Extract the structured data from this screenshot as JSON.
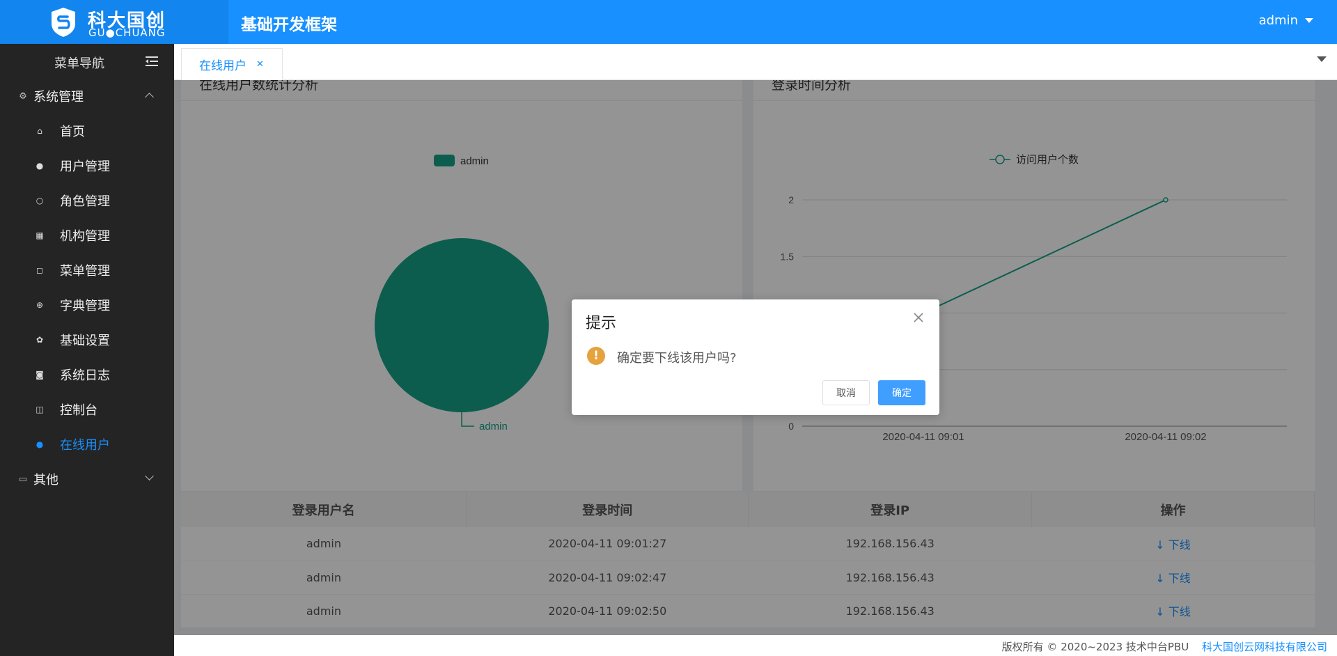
{
  "header": {
    "logo_cn": "科大国创",
    "logo_en": "GU●CHUANG",
    "app_title": "基础开发框架",
    "user": "admin"
  },
  "sidebar": {
    "title": "菜单导航",
    "groups": [
      {
        "label": "系统管理",
        "icon": "settings-gear-icon",
        "expanded": true,
        "items": [
          {
            "label": "首页",
            "icon": "home-icon"
          },
          {
            "label": "用户管理",
            "icon": "user-icon"
          },
          {
            "label": "角色管理",
            "icon": "user-outline-icon"
          },
          {
            "label": "机构管理",
            "icon": "grid-icon"
          },
          {
            "label": "菜单管理",
            "icon": "bag-icon"
          },
          {
            "label": "字典管理",
            "icon": "plus-circle-icon"
          },
          {
            "label": "基础设置",
            "icon": "cog-icon"
          },
          {
            "label": "系统日志",
            "icon": "camera-icon"
          },
          {
            "label": "控制台",
            "icon": "book-icon"
          },
          {
            "label": "在线用户",
            "icon": "user-icon",
            "active": true
          }
        ]
      },
      {
        "label": "其他",
        "icon": "folder-icon",
        "expanded": false
      }
    ]
  },
  "tabs": [
    {
      "label": "在线用户",
      "active": true
    }
  ],
  "cards": {
    "left_title": "在线用户数统计分析",
    "right_title": "登录时间分析"
  },
  "chart_data": [
    {
      "type": "pie",
      "title": "在线用户数统计分析",
      "legend": [
        "admin"
      ],
      "slices": [
        {
          "name": "admin",
          "value": 1
        }
      ],
      "colors": [
        "#16a085"
      ]
    },
    {
      "type": "line",
      "title": "登录时间分析",
      "legend": [
        "访问用户个数"
      ],
      "x": [
        "2020-04-11 09:01",
        "2020-04-11 09:02"
      ],
      "series": [
        {
          "name": "访问用户个数",
          "values": [
            1,
            2
          ]
        }
      ],
      "y_ticks": [
        "2",
        "1.5",
        "1",
        "0.5",
        "0"
      ],
      "ylim": [
        0,
        2
      ],
      "grid": true,
      "colors": [
        "#16a085"
      ]
    }
  ],
  "table": {
    "columns": [
      "登录用户名",
      "登录时间",
      "登录IP",
      "操作"
    ],
    "action_label": "下线",
    "rows": [
      {
        "user": "admin",
        "time": "2020-04-11 09:01:27",
        "ip": "192.168.156.43"
      },
      {
        "user": "admin",
        "time": "2020-04-11 09:02:47",
        "ip": "192.168.156.43"
      },
      {
        "user": "admin",
        "time": "2020-04-11 09:02:50",
        "ip": "192.168.156.43"
      }
    ]
  },
  "dialog": {
    "title": "提示",
    "message": "确定要下线该用户吗?",
    "cancel": "取消",
    "confirm": "确定"
  },
  "footer": {
    "copyright": "版权所有 © 2020~2023 技术中台PBU",
    "company": "科大国创云网科技有限公司"
  },
  "colors": {
    "primary": "#1890ff",
    "sidebar_bg": "#242424",
    "chart": "#16a085",
    "warning": "#e6a23c"
  }
}
